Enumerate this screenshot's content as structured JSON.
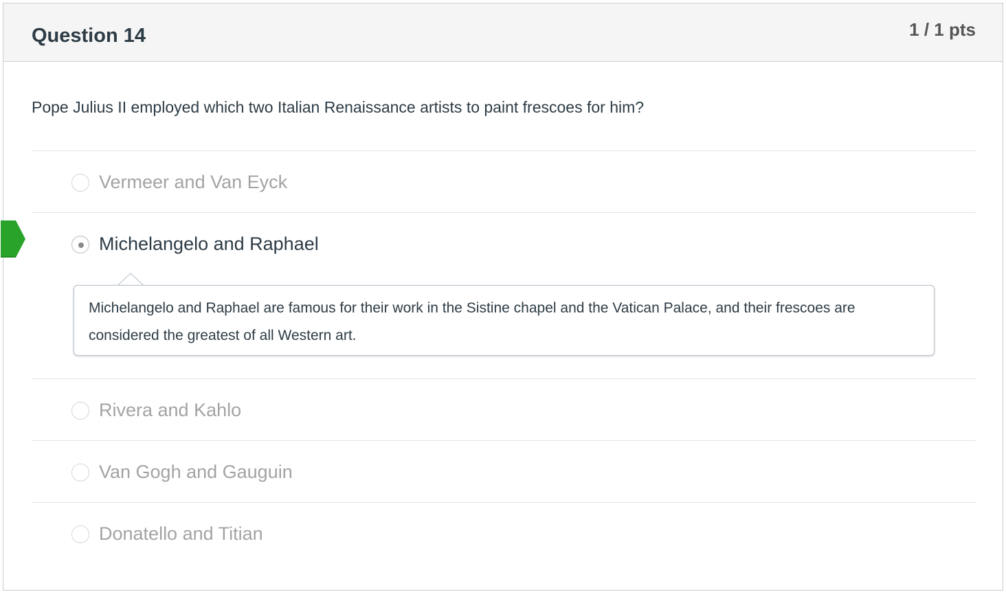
{
  "question": {
    "title": "Question 14",
    "points": "1 / 1 pts",
    "prompt": "Pope Julius II employed which two Italian Renaissance artists to paint frescoes for him?"
  },
  "answers": [
    {
      "label": "Vermeer and Van Eyck",
      "selected": false,
      "correct": false
    },
    {
      "label": "Michelangelo and Raphael",
      "selected": true,
      "correct": true
    },
    {
      "label": "Rivera and Kahlo",
      "selected": false,
      "correct": false
    },
    {
      "label": "Van Gogh and Gauguin",
      "selected": false,
      "correct": false
    },
    {
      "label": "Donatello and Titian",
      "selected": false,
      "correct": false
    }
  ],
  "comment": {
    "text": "Michelangelo and Raphael are famous for their work in the Sistine chapel and the Vatican Palace, and their frescoes are considered the greatest of all Western art."
  },
  "colors": {
    "correct_flag": "#2aa32a",
    "correct_flag_dark": "#1f8c1f",
    "header_bg": "#f5f5f5",
    "border": "#c7cdd1"
  },
  "icons": {
    "correct_marker": "correct-answer-arrow-icon",
    "radio": "radio-button-icon"
  }
}
